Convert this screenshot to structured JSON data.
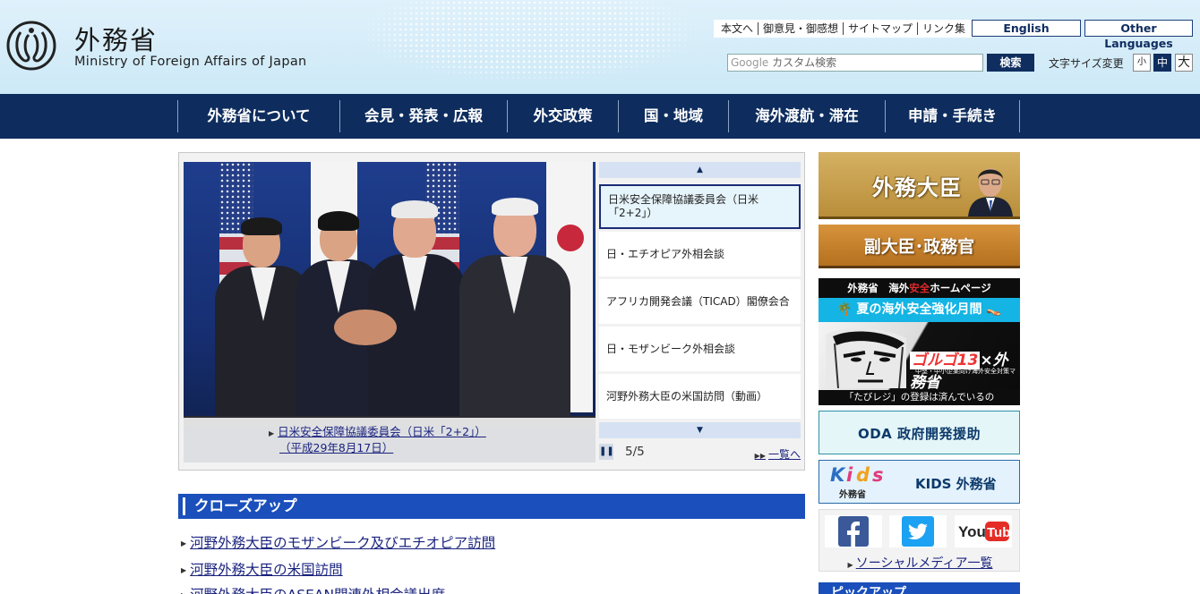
{
  "header": {
    "site_name_ja": "外務省",
    "site_name_en": "Ministry of Foreign Affairs of Japan",
    "util_links": [
      "本文へ",
      "御意見・御感想",
      "サイトマップ",
      "リンク集"
    ],
    "english_label": "English",
    "other_languages_label": "Other Languages",
    "search_placeholder_brand": "Google",
    "search_placeholder": "カスタム検索",
    "search_button": "検索",
    "fontsize_label": "文字サイズ変更",
    "fontsize_small": "小",
    "fontsize_medium": "中",
    "fontsize_large": "大"
  },
  "nav": {
    "items": [
      "外務省について",
      "会見・発表・広報",
      "外交政策",
      "国・地域",
      "海外渡航・滞在",
      "申請・手続き"
    ]
  },
  "carousel": {
    "caption_line1": "日米安全保障協議委員会（日米「2+2」）",
    "caption_line2": "（平成29年8月17日）",
    "items": [
      "日米安全保障協議委員会（日米「2+2」）",
      "日・エチオピア外相会談",
      "アフリカ開発会議（TICAD）閣僚会合",
      "日・モザンビーク外相会談",
      "河野外務大臣の米国訪問（動画）"
    ],
    "active_index": 0,
    "counter": "5/5",
    "more_link": "一覧へ"
  },
  "closeup": {
    "heading": "クローズアップ",
    "items": [
      "河野外務大臣のモザンビーク及びエチオピア訪問",
      "河野外務大臣の米国訪問",
      "河野外務大臣のASEAN関連外相会議出席"
    ]
  },
  "sidebar": {
    "minister": "外務大臣",
    "vice_minister": "副大臣･政務官",
    "safety": {
      "top_prefix": "外務省　海外",
      "top_red": "安全",
      "top_suffix": "ホームページ",
      "campaign": "夏の海外安全強化月間",
      "logo_red": "ゴルゴ13",
      "logo_rest": "×外務省",
      "logo_sub": "中堅・中小企業向け海外安全対策マニュアル",
      "bottom": "「たびレジ」の登録は済んでいるのか・・・・？"
    },
    "oda": "ODA 政府開発援助",
    "kids_logo_letters": [
      "K",
      "i",
      "d",
      "s"
    ],
    "kids_logo_sub": "外務省",
    "kids": "KIDS 外務省",
    "social_link": "ソーシャルメディア一覧",
    "youtube_text": "YouTube",
    "pickup": "ピックアップ"
  },
  "colors": {
    "nav_bg": "#0e2d5e",
    "heading_blue": "#1a4fbc",
    "link": "#1a237e"
  }
}
